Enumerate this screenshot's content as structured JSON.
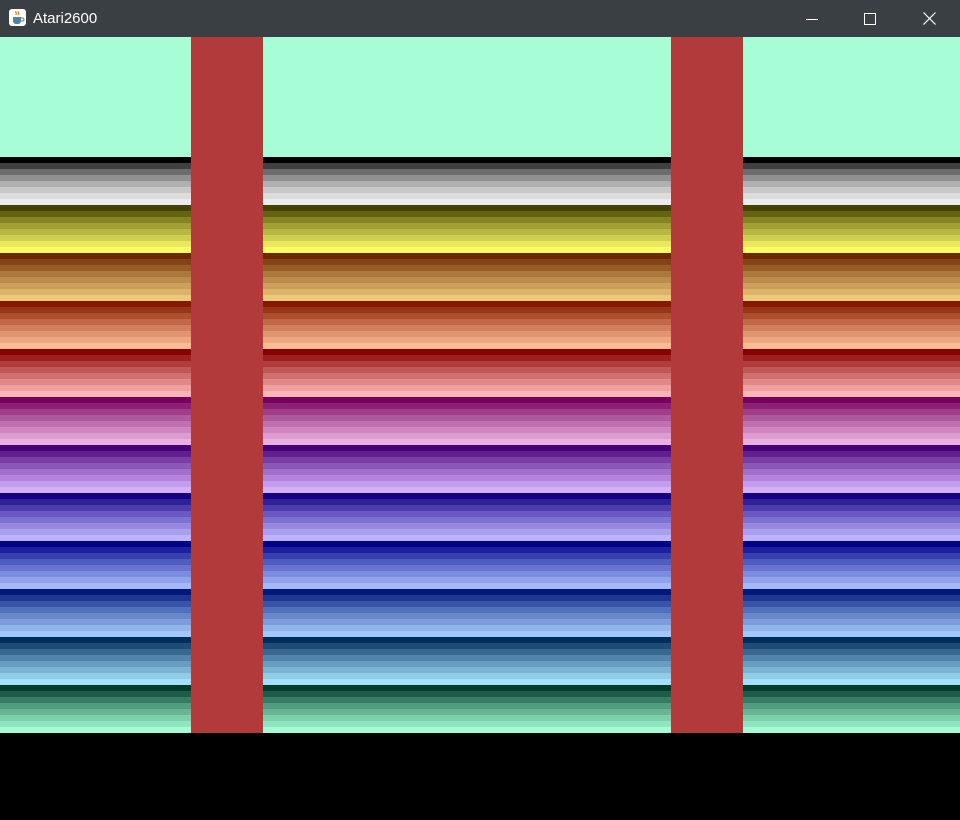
{
  "window": {
    "title": "Atari2600",
    "icon": "java-coffee-cup-icon",
    "controls": [
      "minimize-icon",
      "maximize-icon",
      "close-icon"
    ]
  },
  "colors": {
    "titlebar": "#3a3f44",
    "background": "#a6fdd6",
    "pillar": "#b33a3a",
    "border": "#000000",
    "hue_bands": [
      [
        "#000000",
        "#404040",
        "#6c6c6c",
        "#909090",
        "#b0b0b0",
        "#c8c8c8",
        "#dcdcdc",
        "#ececec"
      ],
      [
        "#444400",
        "#646410",
        "#848424",
        "#a0a034",
        "#b8b840",
        "#d0d050",
        "#e8e85c",
        "#fcfc68"
      ],
      [
        "#702800",
        "#844414",
        "#985c28",
        "#ac783c",
        "#bc8c4c",
        "#cca05c",
        "#dcb468",
        "#ecc878"
      ],
      [
        "#841800",
        "#983418",
        "#ac5030",
        "#c06848",
        "#d0805c",
        "#e09470",
        "#eca880",
        "#fcbc94"
      ],
      [
        "#880000",
        "#9c2020",
        "#b03c3c",
        "#c05858",
        "#d07070",
        "#e08888",
        "#eca0a0",
        "#fcb4b4"
      ],
      [
        "#78005c",
        "#8c2074",
        "#a03c88",
        "#b0589c",
        "#c070b0",
        "#d084c0",
        "#dc9cd0",
        "#ecb0e0"
      ],
      [
        "#480078",
        "#602090",
        "#783ca4",
        "#8c58b8",
        "#a070cc",
        "#b484dc",
        "#c49cec",
        "#d4b0fc"
      ],
      [
        "#140084",
        "#302098",
        "#4c3cac",
        "#6858c0",
        "#7c70d0",
        "#9488e0",
        "#a8a0ec",
        "#bcb4fc"
      ],
      [
        "#000088",
        "#1c209c",
        "#3840b0",
        "#505cc0",
        "#6874d0",
        "#7c8ce0",
        "#90a4ec",
        "#a4b8fc"
      ],
      [
        "#00187c",
        "#1c3890",
        "#3854a8",
        "#5070bc",
        "#6888cc",
        "#7c9cdc",
        "#90b4ec",
        "#a4c8fc"
      ],
      [
        "#002c5c",
        "#1c4c78",
        "#386890",
        "#5084ac",
        "#689cc0",
        "#7cb4d4",
        "#90cce8",
        "#a4e0fc"
      ],
      [
        "#003c2c",
        "#1c5c48",
        "#387c64",
        "#509c80",
        "#68b494",
        "#7cd0ac",
        "#90e4c0",
        "#a4fcd4"
      ]
    ]
  }
}
